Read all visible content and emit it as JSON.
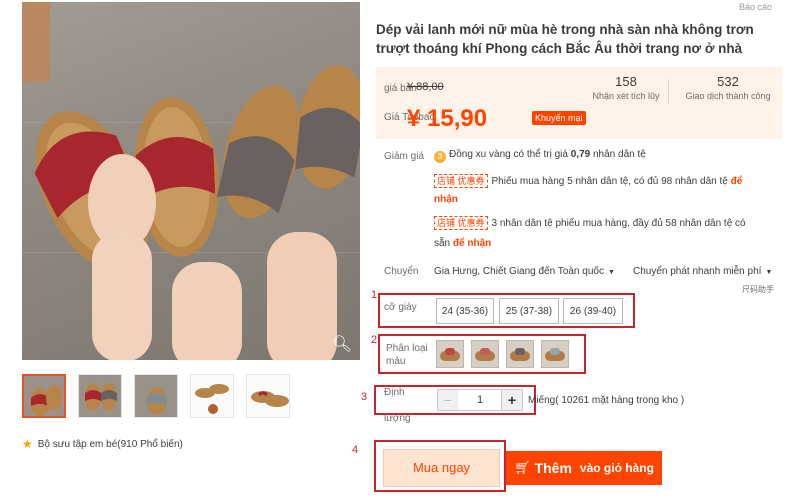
{
  "report": "Báo cáo",
  "product": {
    "title": "Dép vải lanh mới nữ mùa hè trong nhà sàn nhà không trơn trượt thoáng khí Phong cách Bắc Âu thời trang nơ ở nhà"
  },
  "gallery": {
    "favorite_text": "Bộ sưu tập em bé(910 Phổ biến)",
    "zoom_icon": "search-icon"
  },
  "price": {
    "sale_label": "giá bán",
    "old_price": "¥ 88,00",
    "taobao_label": "Giá Taobao",
    "taobao_price": "¥ 15,90",
    "promo_badge": "Khuyến mại",
    "reviews_count": "158",
    "reviews_label": "Nhận xét tích lũy",
    "transactions_count": "532",
    "transactions_label": "Giao dịch thành công"
  },
  "discount": {
    "label": "Giảm giá",
    "coin_text_before": "Đồng xu vàng có thể trị giá ",
    "coin_value": "0,79",
    "coin_text_after": " nhân dân tệ",
    "coupon_tag": "店铺 优惠券",
    "coupon1_text": "Phiếu mua hàng 5 nhân dân tệ, có đủ 98 nhân dân tệ ",
    "coupon1_link_a": "để",
    "coupon1_link_b": "nhận",
    "coupon2_text": "3 nhân dân tệ phiếu mua hàng, đầy đủ 58 nhân dân tệ có",
    "coupon2_text_b": "sẵn ",
    "coupon2_link": "để nhận"
  },
  "shipping": {
    "label": "Chuyển",
    "from": "Gia Hưng, Chiết Giang đến Toàn quốc",
    "method": "Chuyển phát nhanh miễn phí",
    "size_help": "尺码助手"
  },
  "size": {
    "label": "cỡ giày",
    "options": [
      "24 (35-36)",
      "25 (37-38)",
      "26 (39-40)"
    ]
  },
  "variant": {
    "label_line1": "Phân loại",
    "label_line2": "màu"
  },
  "quantity": {
    "label_line1": "Định",
    "label_line2": "lượng",
    "minus": "−",
    "value": "1",
    "plus": "+",
    "stock": "Miếng( 10261 mặt hàng trong kho )"
  },
  "actions": {
    "buy_now": "Mua ngay",
    "add_cart_prefix": "Thêm",
    "add_cart_rest": "vào giỏ hàng"
  },
  "annotations": [
    "1",
    "2",
    "3",
    "4"
  ],
  "colors": {
    "accent": "#ff4400",
    "annotation": "#c1272d",
    "price_bg": "#fff2e8"
  }
}
